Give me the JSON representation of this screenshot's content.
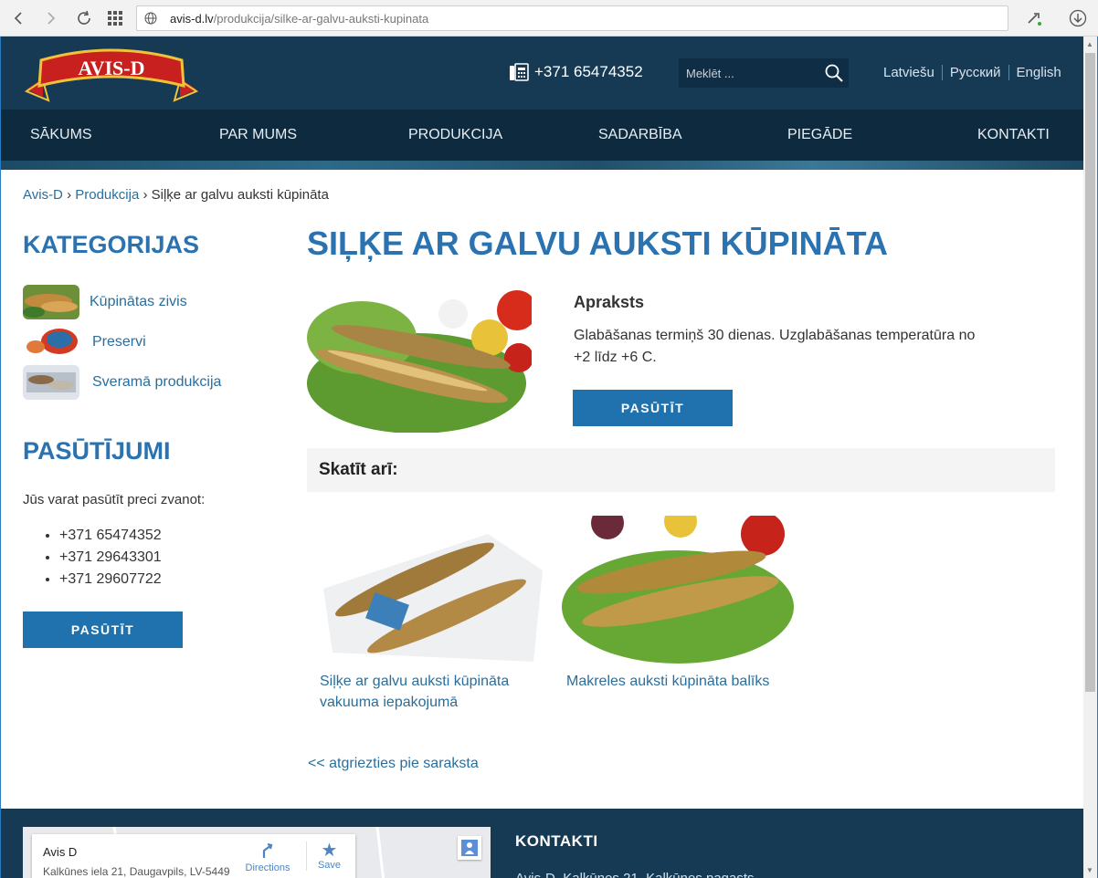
{
  "browser": {
    "url_domain": "avis-d.lv",
    "url_path": "/produkcija/silke-ar-galvu-auksti-kupinata"
  },
  "header": {
    "logo_text": "AVIS-D",
    "phone": "+371 65474352",
    "search_placeholder": "Meklēt ...",
    "languages": [
      "Latviešu",
      "Русский",
      "English"
    ]
  },
  "nav": [
    "SĀKUMS",
    "PAR MUMS",
    "PRODUKCIJA",
    "SADARBĪBA",
    "PIEGĀDE",
    "KONTAKTI"
  ],
  "breadcrumb": {
    "home": "Avis-D",
    "section": "Produkcija",
    "current": "Siļķe ar galvu auksti kūpināta"
  },
  "sidebar": {
    "categories_title": "KATEGORIJAS",
    "categories": [
      "Kūpinātas zivis",
      "Preservi",
      "Sveramā produkcija"
    ],
    "orders_title": "PASŪTĪJUMI",
    "orders_intro": "Jūs varat pasūtīt preci zvanot:",
    "phones": [
      "+371 65474352",
      "+371 29643301",
      "+371 29607722"
    ],
    "order_button": "PASŪTĪT"
  },
  "product": {
    "title": "SIĻĶE AR GALVU AUKSTI KŪPINĀTA",
    "desc_heading": "Apraksts",
    "desc_text": "Glabāšanas termiņš 30 dienas. Uzglabāšanas temperatūra no +2 līdz +6 C.",
    "order_button": "PASŪTĪT"
  },
  "related": {
    "heading": "Skatīt arī:",
    "items": [
      {
        "line1": "Siļķe ar galvu auksti kūpināta",
        "line2": "vakuuma iepakojumā"
      },
      {
        "line1": "Makreles auksti kūpināta balīks",
        "line2": ""
      }
    ]
  },
  "back_link": "<< atgriezties pie saraksta",
  "footer": {
    "map_name": "Avis D",
    "map_address": "Kalkūnes iela 21, Daugavpils, LV-5449",
    "map_directions": "Directions",
    "map_save": "Save",
    "contacts_heading": "KONTAKTI",
    "contacts_line": "Avis-D, Kalkūnes 21, Kalkūnes pagasts"
  },
  "colors": {
    "header_bg": "#163a54",
    "nav_bg": "#0e2a3f",
    "accent": "#2a73b0",
    "button": "#1f72ad"
  }
}
